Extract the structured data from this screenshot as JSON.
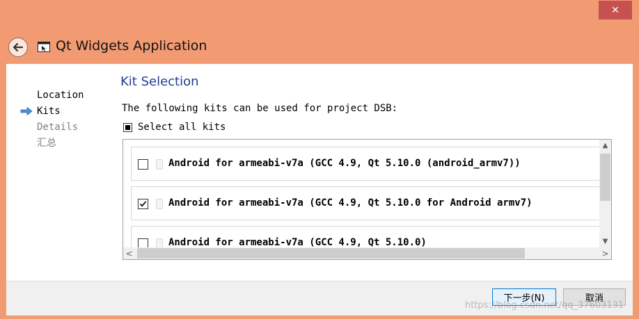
{
  "window": {
    "title": "Qt Widgets Application",
    "close_glyph": "✕",
    "icons": {
      "back": "back-arrow-icon",
      "app": "qt-window-icon",
      "close": "close-icon"
    }
  },
  "steps": [
    {
      "label": "Location",
      "state": "done"
    },
    {
      "label": "Kits",
      "state": "current"
    },
    {
      "label": "Details",
      "state": "pending"
    },
    {
      "label": "汇总",
      "state": "pending"
    }
  ],
  "page": {
    "title": "Kit Selection",
    "description": "The following kits can be used for project DSB:",
    "select_all_label": "Select all kits",
    "select_all_state": "partial"
  },
  "kits": [
    {
      "label": "Android for armeabi-v7a (GCC 4.9, Qt 5.10.0 (android_armv7))",
      "checked": false
    },
    {
      "label": "Android for armeabi-v7a (GCC 4.9, Qt 5.10.0 for Android armv7)",
      "checked": true
    },
    {
      "label": "Android for armeabi-v7a (GCC 4.9, Qt 5.10.0)",
      "checked": false
    }
  ],
  "scrollbars": {
    "up": "▲",
    "down": "▼",
    "left": "<",
    "right": ">"
  },
  "buttons": {
    "next": "下一步(N)",
    "cancel": "取消"
  },
  "watermark": "https://blog.csdn.net/qq_37603131",
  "colors": {
    "frame": "#f29b73",
    "title_accent": "#1c3f94",
    "step_arrow": "#4a90d9",
    "close_button": "#c75050"
  }
}
